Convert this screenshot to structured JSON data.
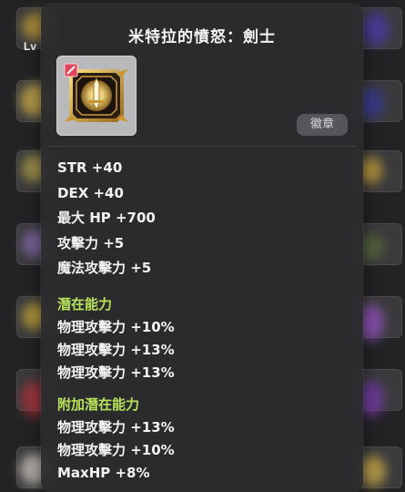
{
  "background": {
    "level_label": "Lv"
  },
  "tooltip": {
    "title": "米特拉的憤怒：劍士",
    "item_icon": "sword-emblem-icon",
    "type_tag": "徽章",
    "base_stats": [
      "STR +40",
      "DEX +40",
      "最大 HP +700",
      "攻擊力 +5",
      "魔法攻擊力 +5"
    ],
    "potential": {
      "title": "潛在能力",
      "lines": [
        "物理攻擊力 +10%",
        "物理攻擊力 +13%",
        "物理攻擊力 +13%"
      ]
    },
    "bonus_potential": {
      "title": "附加潛在能力",
      "lines": [
        "物理攻擊力 +13%",
        "物理攻擊力 +10%",
        "MaxHP +8%"
      ]
    }
  },
  "colors": {
    "section_title": "#b7e35a",
    "tooltip_bg": "#2c2c2e",
    "icon_frame": "#b9b9bb"
  }
}
